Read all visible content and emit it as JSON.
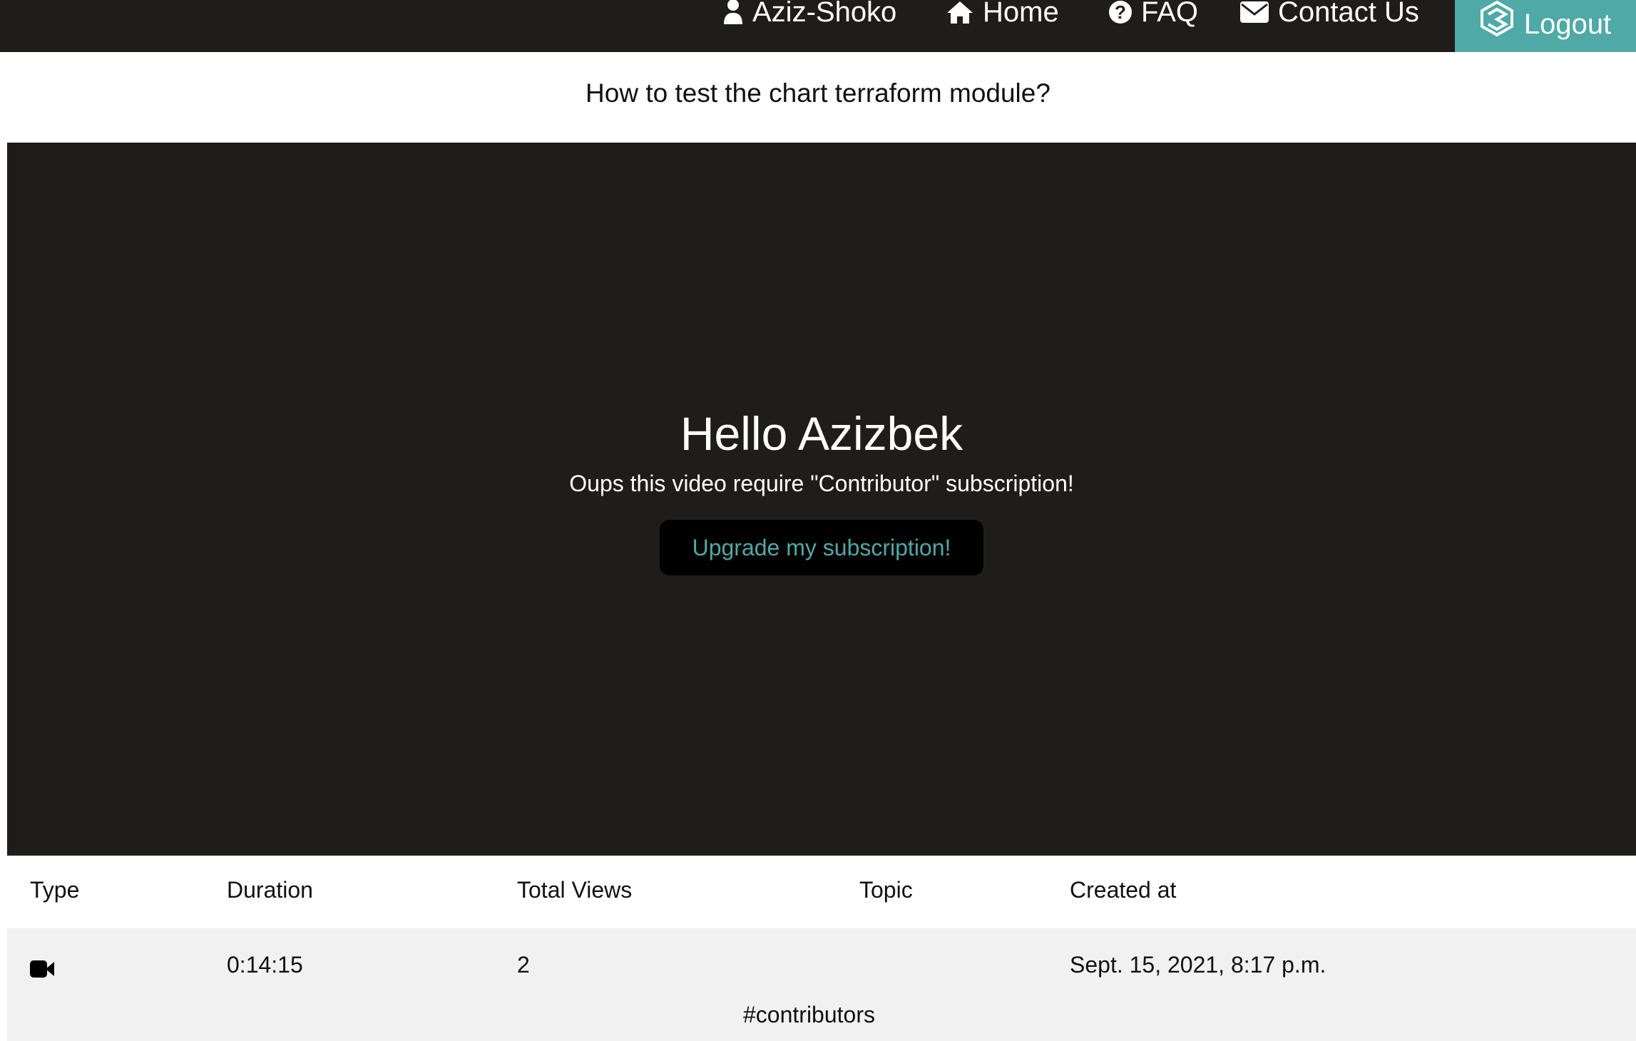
{
  "nav": {
    "user_label": "Aziz-Shoko",
    "home_label": "Home",
    "faq_label": "FAQ",
    "contact_label": "Contact Us",
    "logout_label": "Logout",
    "icons": [
      "user-icon",
      "home-icon",
      "question-circle-icon",
      "envelope-icon",
      "logo-icon"
    ],
    "accent_color": "#4fa9a6"
  },
  "page": {
    "title": "How to test the chart terraform module?"
  },
  "video": {
    "greeting": "Hello Azizbek",
    "message": "Oups this video require \"Contributor\" subscription!",
    "upgrade_label": "Upgrade my subscription!"
  },
  "table": {
    "headers": [
      "Type",
      "Duration",
      "Total Views",
      "Topic",
      "Created at"
    ],
    "rows": [
      {
        "type_icon": "video-camera-icon",
        "duration": "0:14:15",
        "total_views": "2",
        "topic": "#contributors",
        "created_at": "Sept. 15, 2021, 8:17 p.m."
      }
    ]
  }
}
